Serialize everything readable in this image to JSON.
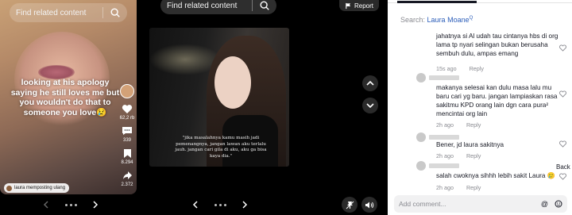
{
  "left_video": {
    "search_text": "Find related content",
    "overlay_text": "looking at his apology saying he still loves me but you wouldn't do that to someone you love😢",
    "likes": "62,2 rb",
    "comments": "339",
    "saves": "8.294",
    "shares": "2.372",
    "repost_label": "laura memposting ulang"
  },
  "middle": {
    "search_text": "Find related content",
    "report_label": "Report",
    "caption": "\"jika masalahnya kamu masih jadi pemenangnya, jangan lawan aku terlalu jauh. jangan cari gila di aku, aku ga bisa kaya dia.\""
  },
  "comments_panel": {
    "search_prefix": "Search:",
    "search_query": "Laura Moane",
    "comments": [
      {
        "text": "jahatnya si Al udah tau cintanya hbs di org lama tp nyari selingan bukan berusaha sembuh dulu, ampas emang",
        "time": "15s ago",
        "reply": "Reply"
      },
      {
        "text": "makanya selesai kan dulu masa lalu mu baru cari yg baru. jangan lampiaskan rasa sakitmu KPD orang lain dgn cara pura² mencintai org lain",
        "time": "2h ago",
        "reply": "Reply"
      },
      {
        "text": "Bener, jd laura sakitnya",
        "time": "2h ago",
        "reply": "Reply"
      },
      {
        "text": "salah cwoknya sihhh lebih sakit Laura 🥲",
        "time": "2h ago",
        "reply": "Reply",
        "extra": "Back"
      }
    ],
    "add_placeholder": "Add comment..."
  },
  "icons": {
    "search": "search-icon",
    "heart": "heart-icon",
    "comment": "comment-bubble-icon",
    "bookmark": "bookmark-icon",
    "share": "share-icon",
    "flag": "flag-icon",
    "chevron_up": "chevron-up-icon",
    "chevron_down": "chevron-down-icon",
    "mute": "volume-icon",
    "pin": "pin-icon"
  }
}
